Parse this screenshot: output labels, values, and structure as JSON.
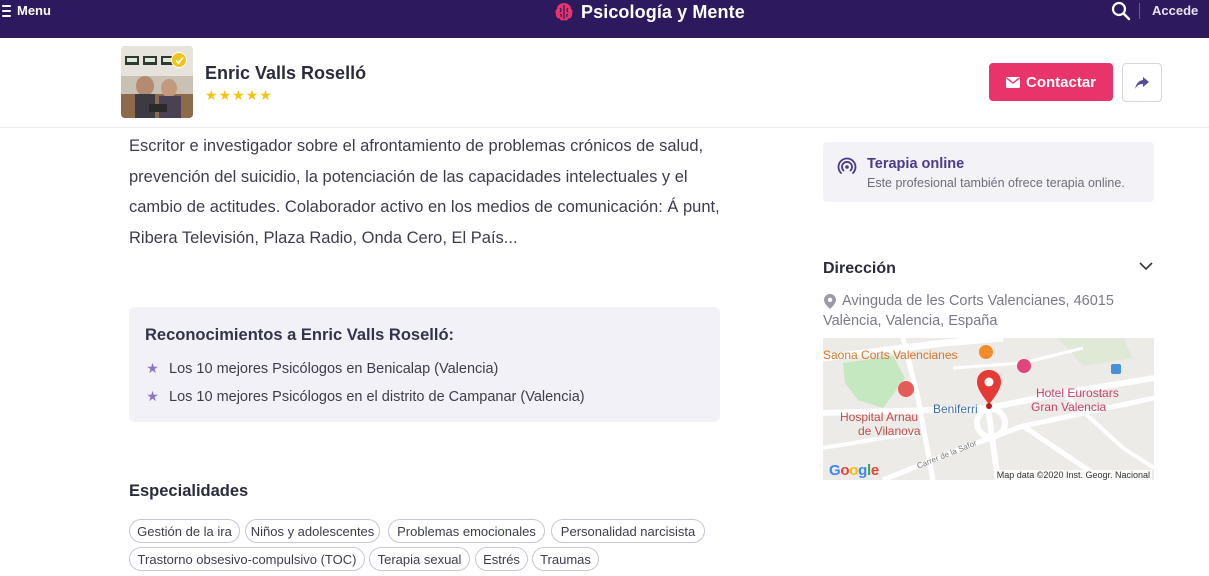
{
  "topbar": {
    "menu_label": "Menu",
    "brand": "Psicología y Mente",
    "login_label": "Accede"
  },
  "profile": {
    "name": "Enric Valls Roselló",
    "rating_stars": 5,
    "contact_label": "Contactar",
    "icons": [
      "verified-icon",
      "star-icon",
      "envelope-icon",
      "share-icon"
    ]
  },
  "bio": "Escritor e investigador sobre el afrontamiento de problemas crónicos de salud, prevención del suicidio, la potenciación de las capacidades intelectuales y el cambio de actitudes. Colaborador activo en los medios de comunicación: Á punt, Ribera Televisión, Plaza Radio, Onda Cero, El País...",
  "awards": {
    "title": "Reconocimientos a Enric Valls Roselló:",
    "items": [
      "Los 10 mejores Psicólogos en Benicalap (Valencia)",
      "Los 10 mejores Psicólogos en el distrito de Campanar (Valencia)"
    ]
  },
  "specialties": {
    "title": "Especialidades",
    "tags": [
      "Gestión de la ira",
      "Niños y adolescentes",
      "Problemas emocionales",
      "Personalidad narcisista",
      "Trastorno obsesivo-compulsivo (TOC)",
      "Terapia sexual",
      "Estrés",
      "Traumas"
    ]
  },
  "online": {
    "title": "Terapia online",
    "subtitle": "Este profesional también ofrece terapia online."
  },
  "address": {
    "title": "Dirección",
    "text": "Avinguda de les Corts Valencianes, 46015 València, Valencia, España"
  },
  "map": {
    "labels": {
      "saona": "Saona Corts Valencianes",
      "hotel_1": "Hotel Eurostars",
      "hotel_2": "Gran Valencia",
      "hospital_1": "Hospital Arnau",
      "hospital_2": "de Vilanova",
      "beniferri": "Beniferri",
      "street": "Carrer de la Safor",
      "google": "Google",
      "credit": "Map data ©2020 Inst. Geogr. Nacional"
    },
    "colors": {
      "park": "#c5e8c1",
      "road": "#ffffff",
      "land": "#ecebe7",
      "marker": "#e53935",
      "poi_food": "#f28b2c",
      "poi_hotel": "#e0457b",
      "poi_hospital": "#e75a5a"
    }
  },
  "colors": {
    "topbar": "#2d1a5e",
    "contact_button": "#e8336b",
    "star": "#f1c40f",
    "accent_purple": "#4b3a8a",
    "awards_bg": "#f3f1f8"
  }
}
